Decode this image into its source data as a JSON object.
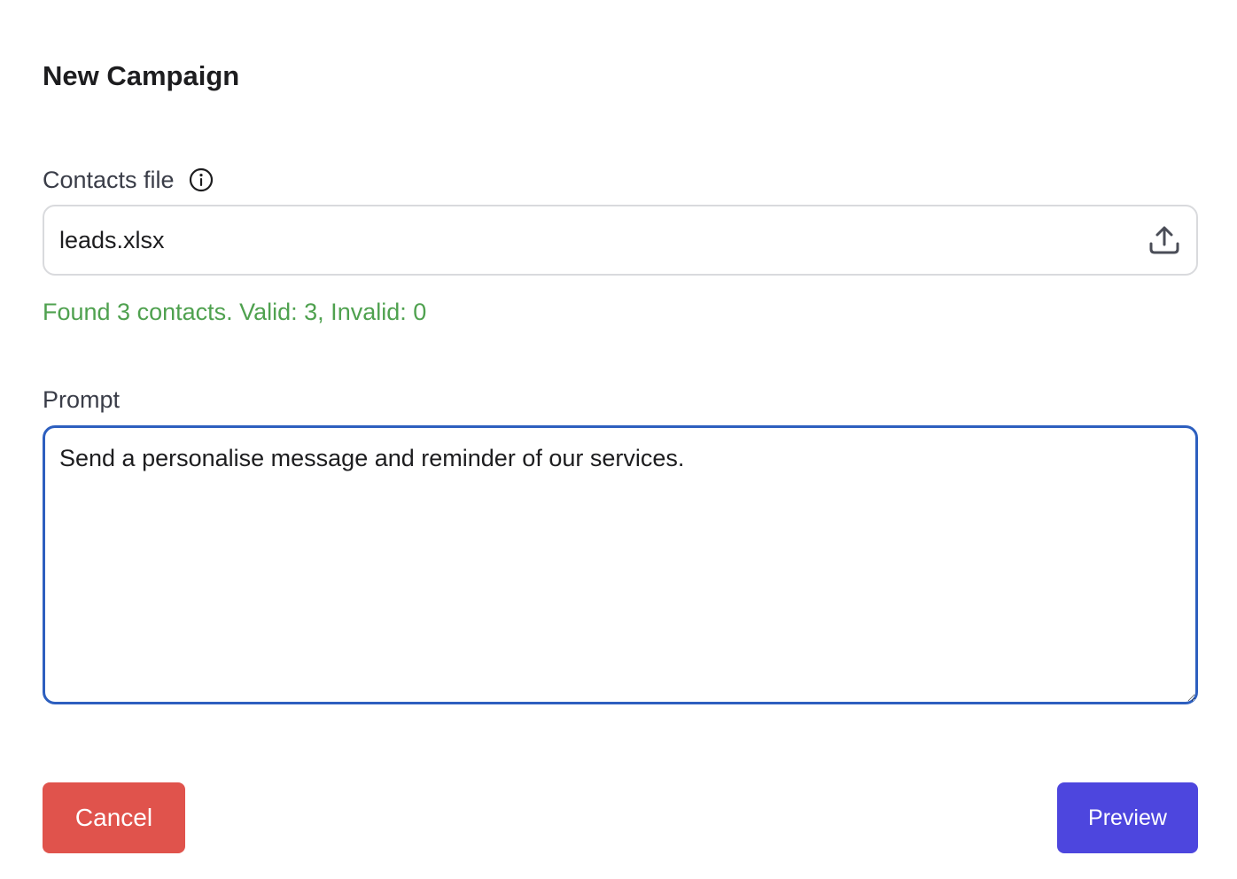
{
  "dialog": {
    "title": "New Campaign"
  },
  "contacts_file": {
    "label": "Contacts file",
    "info_icon": "info-circle-icon",
    "file_name": "leads.xlsx",
    "upload_icon": "upload-icon",
    "status": "Found 3 contacts. Valid: 3, Invalid: 0",
    "status_color": "#4fa14f"
  },
  "prompt": {
    "label": "Prompt",
    "value": "Send a personalise message and reminder of our services.",
    "focus_color": "#2d5fbf"
  },
  "actions": {
    "cancel_label": "Cancel",
    "cancel_color": "#e0534c",
    "preview_label": "Preview",
    "preview_color": "#4d46de"
  }
}
